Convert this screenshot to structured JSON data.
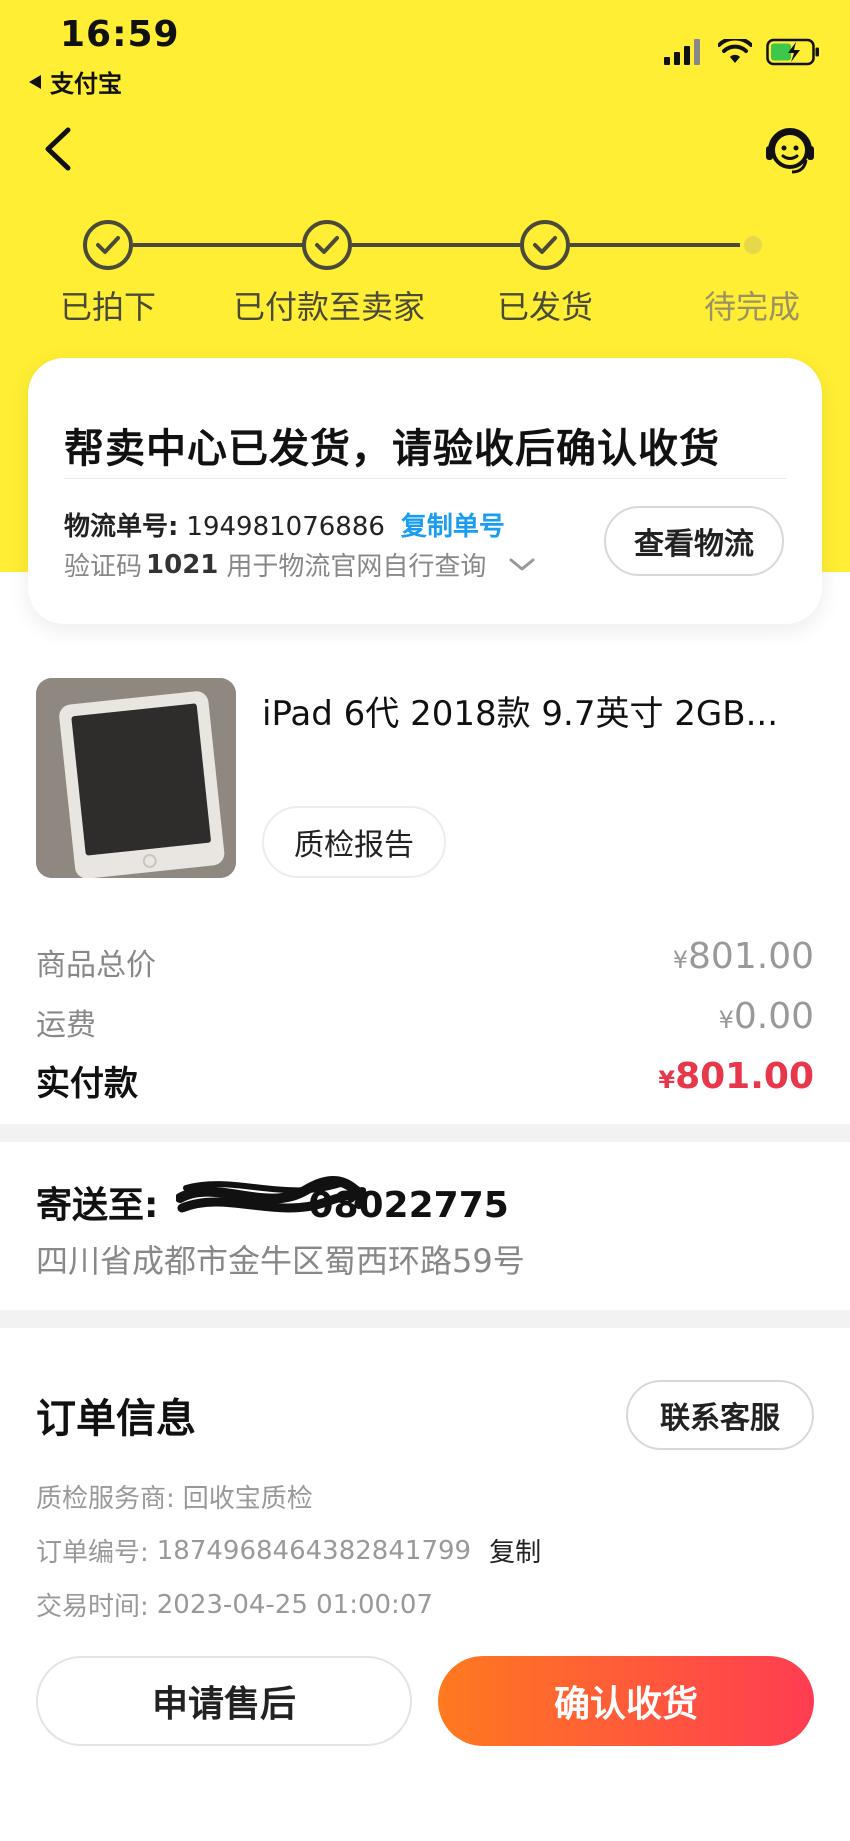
{
  "status_bar": {
    "time": "16:59",
    "back_app": "支付宝"
  },
  "steps": [
    {
      "label": "已拍下",
      "done": true
    },
    {
      "label": "已付款至卖家",
      "done": true
    },
    {
      "label": "已发货",
      "done": true
    },
    {
      "label": "待完成",
      "done": false
    }
  ],
  "shipping": {
    "title": "帮卖中心已发货，请验收后确认收货",
    "tracking_label": "物流单号:",
    "tracking_number": "194981076886",
    "copy_tracking": "复制单号",
    "verify_prefix": "验证码",
    "verify_code": "1021",
    "verify_suffix": "用于物流官网自行查询",
    "view_logistics": "查看物流"
  },
  "product": {
    "title": "iPad 6代 2018款 9.7英寸 2GB...",
    "report_button": "质检报告"
  },
  "prices": {
    "total_label": "商品总价",
    "total_value": "801.00",
    "shipping_label": "运费",
    "shipping_value": "0.00",
    "paid_label": "实付款",
    "paid_value": "801.00",
    "currency": "¥"
  },
  "address": {
    "prefix": "寄送至:",
    "visible_phone_tail": "08022775",
    "line": "四川省成都市金牛区蜀西环路59号"
  },
  "order": {
    "title": "订单信息",
    "service_button": "联系客服",
    "inspector_label": "质检服务商:",
    "inspector_value": "回收宝质检",
    "order_no_label": "订单编号:",
    "order_no_value": "1874968464382841799",
    "copy": "复制",
    "time_label": "交易时间:",
    "time_value": "2023-04-25 01:00:07"
  },
  "actions": {
    "after_sale": "申请售后",
    "confirm": "确认收货"
  },
  "colors": {
    "header_bg": "#FFEE33",
    "accent_blue": "#1a9cf0",
    "price_red": "#E8364A",
    "confirm_gradient_start": "#FF7A1F",
    "confirm_gradient_end": "#FF3C52"
  },
  "icons": [
    "back-arrow-icon",
    "customer-service-icon",
    "check-icon",
    "chevron-down-icon",
    "signal-icon",
    "wifi-icon",
    "battery-icon"
  ]
}
